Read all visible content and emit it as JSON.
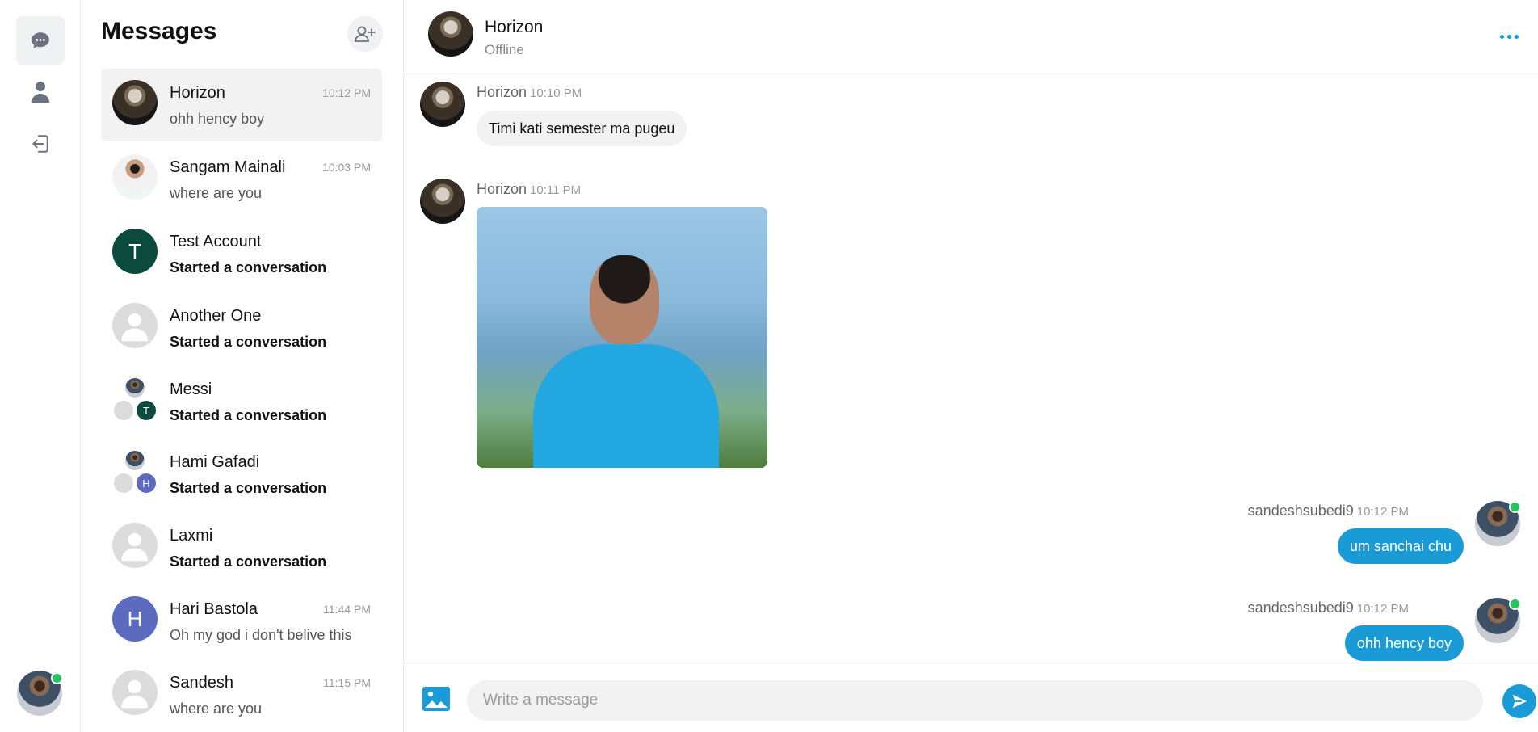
{
  "sidebar": {
    "title": "Messages",
    "conversations": [
      {
        "name": "Horizon",
        "preview": "ohh hency boy",
        "time": "10:12 PM"
      },
      {
        "name": "Sangam Mainali",
        "preview": "where are you",
        "time": "10:03 PM"
      },
      {
        "name": "Test Account",
        "preview": "Started a conversation",
        "time": "",
        "initial": "T"
      },
      {
        "name": "Another One",
        "preview": "Started a conversation",
        "time": ""
      },
      {
        "name": "Messi",
        "preview": "Started a conversation",
        "time": "",
        "initial": "T"
      },
      {
        "name": "Hami Gafadi",
        "preview": "Started a conversation",
        "time": "",
        "initial": "H"
      },
      {
        "name": "Laxmi",
        "preview": "Started a conversation",
        "time": ""
      },
      {
        "name": "Hari Bastola",
        "preview": "Oh my god i don't belive this",
        "time": "11:44 PM",
        "initial": "H"
      },
      {
        "name": "Sandesh",
        "preview": "where are you",
        "time": "11:15 PM"
      }
    ]
  },
  "chat": {
    "contact_name": "Horizon",
    "contact_status": "Offline",
    "messages": [
      {
        "sender": "Horizon",
        "time": "10:10 PM",
        "text": "Timi kati semester ma pugeu"
      },
      {
        "sender": "Horizon",
        "time": "10:11 PM"
      },
      {
        "sender": "sandeshsubedi9",
        "time": "10:12 PM",
        "text": "um sanchai chu"
      },
      {
        "sender": "sandeshsubedi9",
        "time": "10:12 PM",
        "text": "ohh hency boy"
      }
    ]
  },
  "composer": {
    "placeholder": "Write a message",
    "value": ""
  },
  "colors": {
    "accent": "#1a9bd7",
    "online": "#22c55e",
    "teal_avatar": "#0b4a3c",
    "indigo_avatar": "#5c6bc0"
  },
  "icons": [
    "chat-icon",
    "user-icon",
    "logout-icon",
    "add-user-icon",
    "more-icon",
    "image-icon",
    "send-icon"
  ]
}
